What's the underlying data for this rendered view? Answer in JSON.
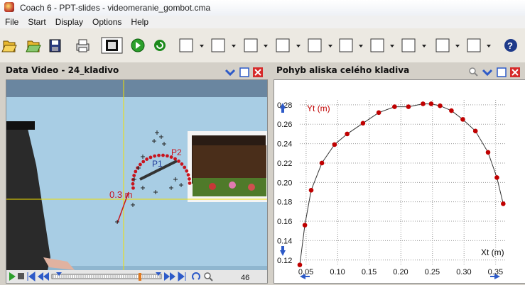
{
  "window": {
    "title": "Coach 6 - PPT-slides - videomeranie_gombot.cma"
  },
  "menu": [
    "File",
    "Start",
    "Display",
    "Options",
    "Help"
  ],
  "video_panel": {
    "title": "Data Video - 24_kladivo",
    "labels": {
      "scale": "0.3 m",
      "p1": "P1",
      "p2": "P2"
    },
    "frame_number": "46",
    "colors": {
      "track_red": "#c8141e",
      "axis_yellow": "#f2e000"
    }
  },
  "graph_panel": {
    "title": "Pohyb aliska celého kladiva"
  },
  "chart_data": {
    "type": "line",
    "ylabel": "Yt (m)",
    "xlabel": "Xt (m)",
    "xlim": [
      0.04,
      0.365
    ],
    "ylim": [
      0.114,
      0.285
    ],
    "x_ticks": [
      "0.05",
      "0.10",
      "0.15",
      "0.20",
      "0.25",
      "0.30",
      "0.35"
    ],
    "y_ticks": [
      "0.28",
      "0.26",
      "0.24",
      "0.22",
      "0.20",
      "0.18",
      "0.16",
      "0.14",
      "0.12"
    ],
    "series": [
      {
        "color": "#c00000",
        "x": [
          0.04,
          0.048,
          0.058,
          0.075,
          0.095,
          0.115,
          0.14,
          0.165,
          0.19,
          0.212,
          0.235,
          0.248,
          0.262,
          0.28,
          0.298,
          0.318,
          0.338,
          0.352,
          0.362
        ],
        "y": [
          0.115,
          0.156,
          0.192,
          0.22,
          0.239,
          0.25,
          0.261,
          0.272,
          0.278,
          0.278,
          0.281,
          0.281,
          0.279,
          0.274,
          0.265,
          0.253,
          0.231,
          0.205,
          0.178
        ]
      }
    ]
  }
}
